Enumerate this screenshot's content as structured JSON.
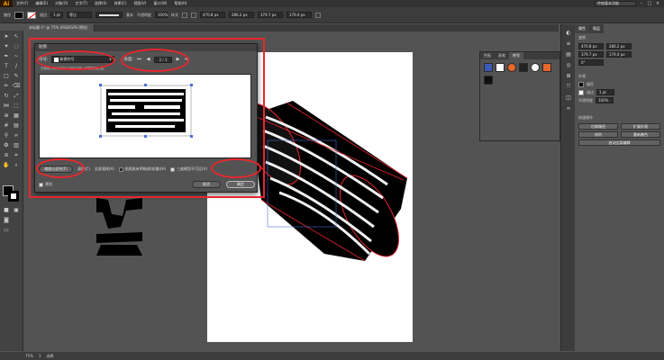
{
  "app": {
    "logo": "Ai",
    "menu": [
      "文件(F)",
      "编辑(E)",
      "对象(O)",
      "文字(T)",
      "选择(S)",
      "效果(C)",
      "视图(V)",
      "窗口(W)",
      "帮助(H)"
    ],
    "workspace": "传统基本功能"
  },
  "control_bar": {
    "object_label": "路径",
    "stroke_label": "描边",
    "stroke_weight": "1 pt",
    "stroke_style": "等比",
    "brush_label": "基本",
    "opacity_label": "不透明度",
    "opacity_value": "100%",
    "style_label": "样式",
    "x_value": "470.8 px",
    "y_value": "286.2 px",
    "w_value": "379.7 px",
    "h_value": "179.4 px"
  },
  "document": {
    "tab_label": "未标题-1* @ 75% (RGB/GPU 预览)"
  },
  "symbols_panel": {
    "tabs": [
      "色板",
      "画笔",
      "符号"
    ],
    "active_tab": "符号"
  },
  "properties": {
    "tabs": [
      "属性",
      "图层"
    ],
    "section_transform": "变换",
    "x": "470.8 px",
    "y": "286.2 px",
    "w": "379.7 px",
    "h": "179.4 px",
    "angle": "0°",
    "section_appearance": "外观",
    "fill_label": "填色",
    "stroke_label": "描边",
    "stroke_value": "1 pt",
    "opacity_label": "不透明度",
    "opacity_value": "100%",
    "section_quick": "快速操作",
    "btn_offset": "位移路径",
    "btn_expand": "扩展外观",
    "btn_arrange": "排列",
    "btn_recolor": "重新着色",
    "btn_isolate": "启动全局编辑"
  },
  "dialog": {
    "title": "贴图",
    "symbol_label": "符号:",
    "symbol_value": "新建符号",
    "page_label": "表面:",
    "page_value": "2 / 3",
    "hint": "在画板中拖动或按下鼠标左键以调整图稿位置。",
    "opt_scale": "缩放以适合(F)",
    "opt_clear": "清除(C)",
    "opt_clear_all": "全部清除(A)",
    "opt_shade": "贴图具有明暗调(较慢)(H)",
    "opt_hidden": "三维模型不可见(V)",
    "preview_label": "预览",
    "cancel": "取消",
    "ok": "确定"
  },
  "statusbar": {
    "zoom": "75%",
    "page": "1",
    "tool": "选择"
  },
  "colors": {
    "highlight": "#e8262f",
    "accent": "#ff9a00"
  }
}
